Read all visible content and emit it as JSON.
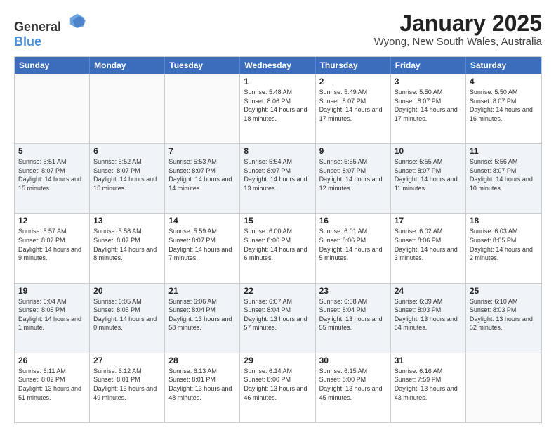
{
  "header": {
    "logo_general": "General",
    "logo_blue": "Blue",
    "month": "January 2025",
    "location": "Wyong, New South Wales, Australia"
  },
  "days_of_week": [
    "Sunday",
    "Monday",
    "Tuesday",
    "Wednesday",
    "Thursday",
    "Friday",
    "Saturday"
  ],
  "weeks": [
    [
      {
        "day": "",
        "empty": true
      },
      {
        "day": "",
        "empty": true
      },
      {
        "day": "",
        "empty": true
      },
      {
        "day": "1",
        "sunrise": "5:48 AM",
        "sunset": "8:06 PM",
        "daylight": "14 hours and 18 minutes."
      },
      {
        "day": "2",
        "sunrise": "5:49 AM",
        "sunset": "8:07 PM",
        "daylight": "14 hours and 17 minutes."
      },
      {
        "day": "3",
        "sunrise": "5:50 AM",
        "sunset": "8:07 PM",
        "daylight": "14 hours and 17 minutes."
      },
      {
        "day": "4",
        "sunrise": "5:50 AM",
        "sunset": "8:07 PM",
        "daylight": "14 hours and 16 minutes."
      }
    ],
    [
      {
        "day": "5",
        "sunrise": "5:51 AM",
        "sunset": "8:07 PM",
        "daylight": "14 hours and 15 minutes."
      },
      {
        "day": "6",
        "sunrise": "5:52 AM",
        "sunset": "8:07 PM",
        "daylight": "14 hours and 15 minutes."
      },
      {
        "day": "7",
        "sunrise": "5:53 AM",
        "sunset": "8:07 PM",
        "daylight": "14 hours and 14 minutes."
      },
      {
        "day": "8",
        "sunrise": "5:54 AM",
        "sunset": "8:07 PM",
        "daylight": "14 hours and 13 minutes."
      },
      {
        "day": "9",
        "sunrise": "5:55 AM",
        "sunset": "8:07 PM",
        "daylight": "14 hours and 12 minutes."
      },
      {
        "day": "10",
        "sunrise": "5:55 AM",
        "sunset": "8:07 PM",
        "daylight": "14 hours and 11 minutes."
      },
      {
        "day": "11",
        "sunrise": "5:56 AM",
        "sunset": "8:07 PM",
        "daylight": "14 hours and 10 minutes."
      }
    ],
    [
      {
        "day": "12",
        "sunrise": "5:57 AM",
        "sunset": "8:07 PM",
        "daylight": "14 hours and 9 minutes."
      },
      {
        "day": "13",
        "sunrise": "5:58 AM",
        "sunset": "8:07 PM",
        "daylight": "14 hours and 8 minutes."
      },
      {
        "day": "14",
        "sunrise": "5:59 AM",
        "sunset": "8:07 PM",
        "daylight": "14 hours and 7 minutes."
      },
      {
        "day": "15",
        "sunrise": "6:00 AM",
        "sunset": "8:06 PM",
        "daylight": "14 hours and 6 minutes."
      },
      {
        "day": "16",
        "sunrise": "6:01 AM",
        "sunset": "8:06 PM",
        "daylight": "14 hours and 5 minutes."
      },
      {
        "day": "17",
        "sunrise": "6:02 AM",
        "sunset": "8:06 PM",
        "daylight": "14 hours and 3 minutes."
      },
      {
        "day": "18",
        "sunrise": "6:03 AM",
        "sunset": "8:05 PM",
        "daylight": "14 hours and 2 minutes."
      }
    ],
    [
      {
        "day": "19",
        "sunrise": "6:04 AM",
        "sunset": "8:05 PM",
        "daylight": "14 hours and 1 minute."
      },
      {
        "day": "20",
        "sunrise": "6:05 AM",
        "sunset": "8:05 PM",
        "daylight": "14 hours and 0 minutes."
      },
      {
        "day": "21",
        "sunrise": "6:06 AM",
        "sunset": "8:04 PM",
        "daylight": "13 hours and 58 minutes."
      },
      {
        "day": "22",
        "sunrise": "6:07 AM",
        "sunset": "8:04 PM",
        "daylight": "13 hours and 57 minutes."
      },
      {
        "day": "23",
        "sunrise": "6:08 AM",
        "sunset": "8:04 PM",
        "daylight": "13 hours and 55 minutes."
      },
      {
        "day": "24",
        "sunrise": "6:09 AM",
        "sunset": "8:03 PM",
        "daylight": "13 hours and 54 minutes."
      },
      {
        "day": "25",
        "sunrise": "6:10 AM",
        "sunset": "8:03 PM",
        "daylight": "13 hours and 52 minutes."
      }
    ],
    [
      {
        "day": "26",
        "sunrise": "6:11 AM",
        "sunset": "8:02 PM",
        "daylight": "13 hours and 51 minutes."
      },
      {
        "day": "27",
        "sunrise": "6:12 AM",
        "sunset": "8:01 PM",
        "daylight": "13 hours and 49 minutes."
      },
      {
        "day": "28",
        "sunrise": "6:13 AM",
        "sunset": "8:01 PM",
        "daylight": "13 hours and 48 minutes."
      },
      {
        "day": "29",
        "sunrise": "6:14 AM",
        "sunset": "8:00 PM",
        "daylight": "13 hours and 46 minutes."
      },
      {
        "day": "30",
        "sunrise": "6:15 AM",
        "sunset": "8:00 PM",
        "daylight": "13 hours and 45 minutes."
      },
      {
        "day": "31",
        "sunrise": "6:16 AM",
        "sunset": "7:59 PM",
        "daylight": "13 hours and 43 minutes."
      },
      {
        "day": "",
        "empty": true
      }
    ]
  ]
}
